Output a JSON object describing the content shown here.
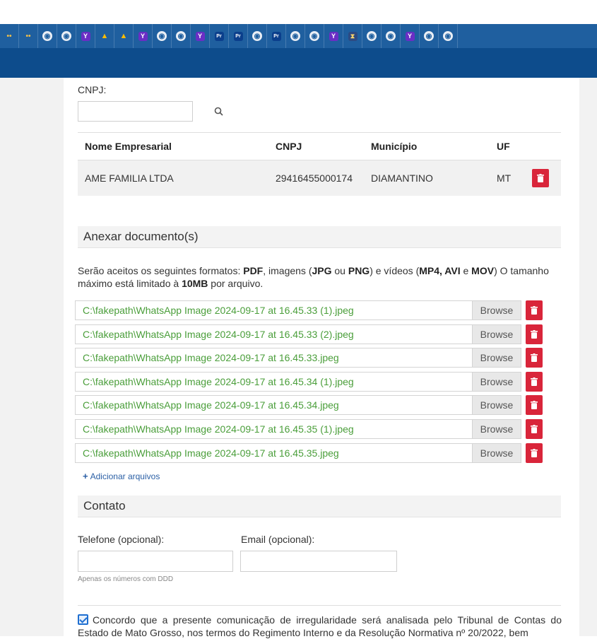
{
  "tabs": [
    "dots",
    "dots",
    "globe",
    "globe",
    "yahoo",
    "drive",
    "drive",
    "yahoo",
    "globe",
    "globe",
    "yahoo",
    "pdf",
    "pdf",
    "globe",
    "pdf",
    "globe",
    "globe",
    "yahoo",
    "hour",
    "globe",
    "globe",
    "yahoo",
    "globe",
    "globe"
  ],
  "cnpj_search": {
    "label": "CNPJ:",
    "value": ""
  },
  "company_table": {
    "headers": [
      "Nome Empresarial",
      "CNPJ",
      "Município",
      "UF"
    ],
    "row": {
      "name": "AME FAMILIA LTDA",
      "cnpj": "29416455000174",
      "municipio": "DIAMANTINO",
      "uf": "MT"
    }
  },
  "attachments": {
    "title": "Anexar documento(s)",
    "desc_1": "Serão aceitos os seguintes formatos: ",
    "desc_pdf": "PDF",
    "desc_2": ", imagens (",
    "desc_jpg": "JPG",
    "desc_3": " ou ",
    "desc_png": "PNG",
    "desc_4": ") e vídeos (",
    "desc_mp4avi": "MP4, AVI",
    "desc_5": " e ",
    "desc_mov": "MOV",
    "desc_6": ") O tamanho máximo está limitado à ",
    "desc_10mb": "10MB",
    "desc_7": " por arquivo.",
    "browse_label": "Browse",
    "files": [
      "C:\\fakepath\\WhatsApp Image 2024-09-17 at 16.45.33 (1).jpeg",
      "C:\\fakepath\\WhatsApp Image 2024-09-17 at 16.45.33 (2).jpeg",
      "C:\\fakepath\\WhatsApp Image 2024-09-17 at 16.45.33.jpeg",
      "C:\\fakepath\\WhatsApp Image 2024-09-17 at 16.45.34 (1).jpeg",
      "C:\\fakepath\\WhatsApp Image 2024-09-17 at 16.45.34.jpeg",
      "C:\\fakepath\\WhatsApp Image 2024-09-17 at 16.45.35 (1).jpeg",
      "C:\\fakepath\\WhatsApp Image 2024-09-17 at 16.45.35.jpeg"
    ],
    "add_files": "Adicionar arquivos"
  },
  "contact": {
    "title": "Contato",
    "phone_label": "Telefone (opcional):",
    "email_label": "Email (opcional):",
    "phone_value": "",
    "email_value": "",
    "phone_hint": "Apenas os números com DDD"
  },
  "consent": {
    "checked": true,
    "text": "Concordo que a presente comunicação de irregularidade será analisada pelo Tribunal de Contas do Estado de Mato Grosso, nos termos do Regimento Interno e da Resolução Normativa nº 20/2022, bem"
  },
  "colors": {
    "navbar": "#0d4c8c",
    "tabstrip": "#1f5f9f",
    "danger": "#d9253a",
    "file_text": "#4a9e3a",
    "link": "#2a5fa5"
  }
}
